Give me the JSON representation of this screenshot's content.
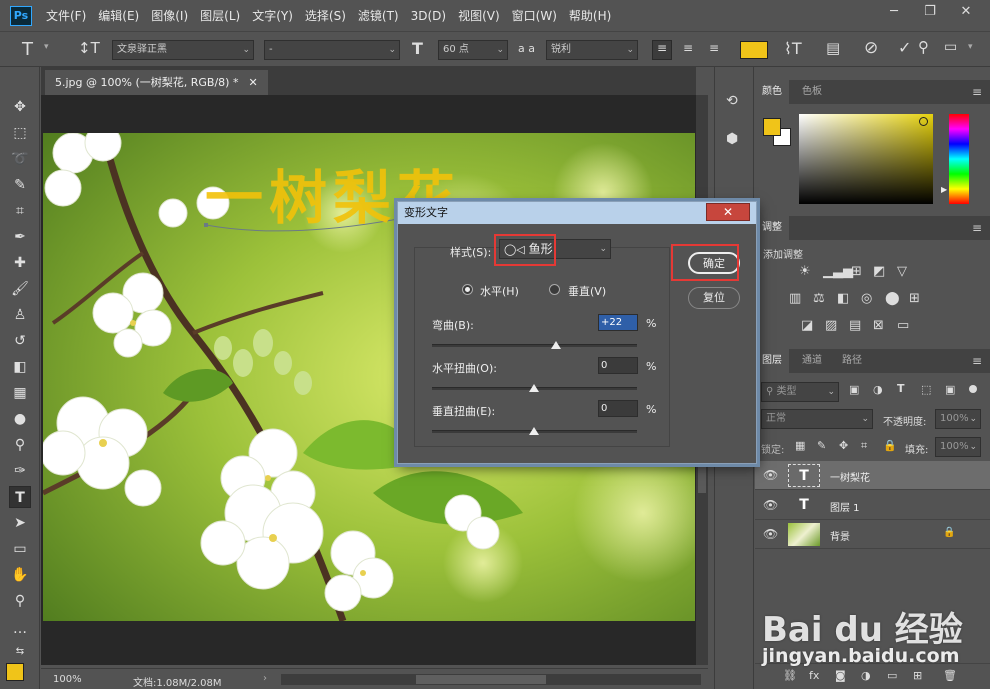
{
  "app": {
    "logo": "Ps"
  },
  "menu": [
    "文件(F)",
    "编辑(E)",
    "图像(I)",
    "图层(L)",
    "文字(Y)",
    "选择(S)",
    "滤镜(T)",
    "3D(D)",
    "视图(V)",
    "窗口(W)",
    "帮助(H)"
  ],
  "window_controls": [
    "minimize-icon",
    "restore-icon",
    "close-icon"
  ],
  "options": {
    "tool_icon": "text-tool-icon",
    "font_family": "文泉驿正黑",
    "font_style": "-",
    "font_size": "60 点",
    "aa_icon_label": "a a",
    "antialias": "锐利",
    "color_swatch": "#f0c419"
  },
  "document": {
    "tab_title": "5.jpg @ 100% (一树梨花, RGB/8) *",
    "text_on_canvas": "一树梨花",
    "text_color": "#f2c20a"
  },
  "status": {
    "zoom": "100%",
    "doc_size": "文档:1.08M/2.08M"
  },
  "dialog": {
    "title": "变形文字",
    "style_label": "样式(S):",
    "style_value": "鱼形",
    "horizontal_label": "水平(H)",
    "vertical_label": "垂直(V)",
    "orientation": "horizontal",
    "bend_label": "弯曲(B):",
    "bend_value": "+22",
    "hdistort_label": "水平扭曲(O):",
    "hdistort_value": "0",
    "vdistort_label": "垂直扭曲(E):",
    "vdistort_value": "0",
    "percent": "%",
    "ok_label": "确定",
    "reset_label": "复位"
  },
  "panels": {
    "color_tabs": [
      "颜色",
      "色板"
    ],
    "fg_color": "#f0c419",
    "adjust_tab": "调整",
    "adjust_title": "添加调整",
    "layer_tabs": [
      "图层",
      "通道",
      "路径"
    ],
    "kind_filter": "类型",
    "blend_mode": "正常",
    "opacity_label": "不透明度:",
    "opacity_value": "100%",
    "lock_label": "锁定:",
    "fill_label": "填充:",
    "fill_value": "100%",
    "layers": [
      {
        "name": "一树梨花",
        "type": "text"
      },
      {
        "name": "图层 1",
        "type": "text"
      },
      {
        "name": "背景",
        "type": "image"
      }
    ]
  },
  "watermark": {
    "brand": "Bai du 经验",
    "url": "jingyan.baidu.com"
  }
}
